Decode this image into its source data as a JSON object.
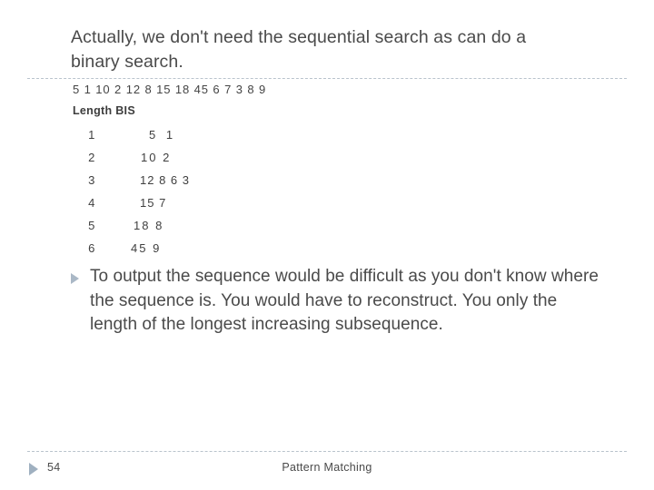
{
  "slide": {
    "title_line1": "Actually, we don't need the sequential search as can do a",
    "title_line2": "binary search.",
    "sequence": "5 1 10 2 12 8 15 18 45 6 7 3 8 9",
    "table_header": "Length BIS",
    "table": {
      "rows": [
        {
          "length": "1",
          "values": "5   1"
        },
        {
          "length": "2",
          "values": "10  2"
        },
        {
          "length": "3",
          "values": "12 8 6 3"
        },
        {
          "length": "4",
          "values": "15 7"
        },
        {
          "length": "5",
          "values": "18  8"
        },
        {
          "length": "6",
          "values": "45  9"
        }
      ]
    },
    "bullet": {
      "marker": "triangle-bullet",
      "text": "To output the sequence would be difficult as you don't know where the sequence is.  You would have to reconstruct.  You only the length of the longest increasing subsequence."
    }
  },
  "footer": {
    "page_number": "54",
    "center_label": "Pattern Matching",
    "marker": "triangle-bullet"
  },
  "colors": {
    "text": "#4a4a4a",
    "rule": "#b9c3cc",
    "bullet": "#aab8c6",
    "footer_marker": "#9fb0c0",
    "background": "#ffffff"
  }
}
